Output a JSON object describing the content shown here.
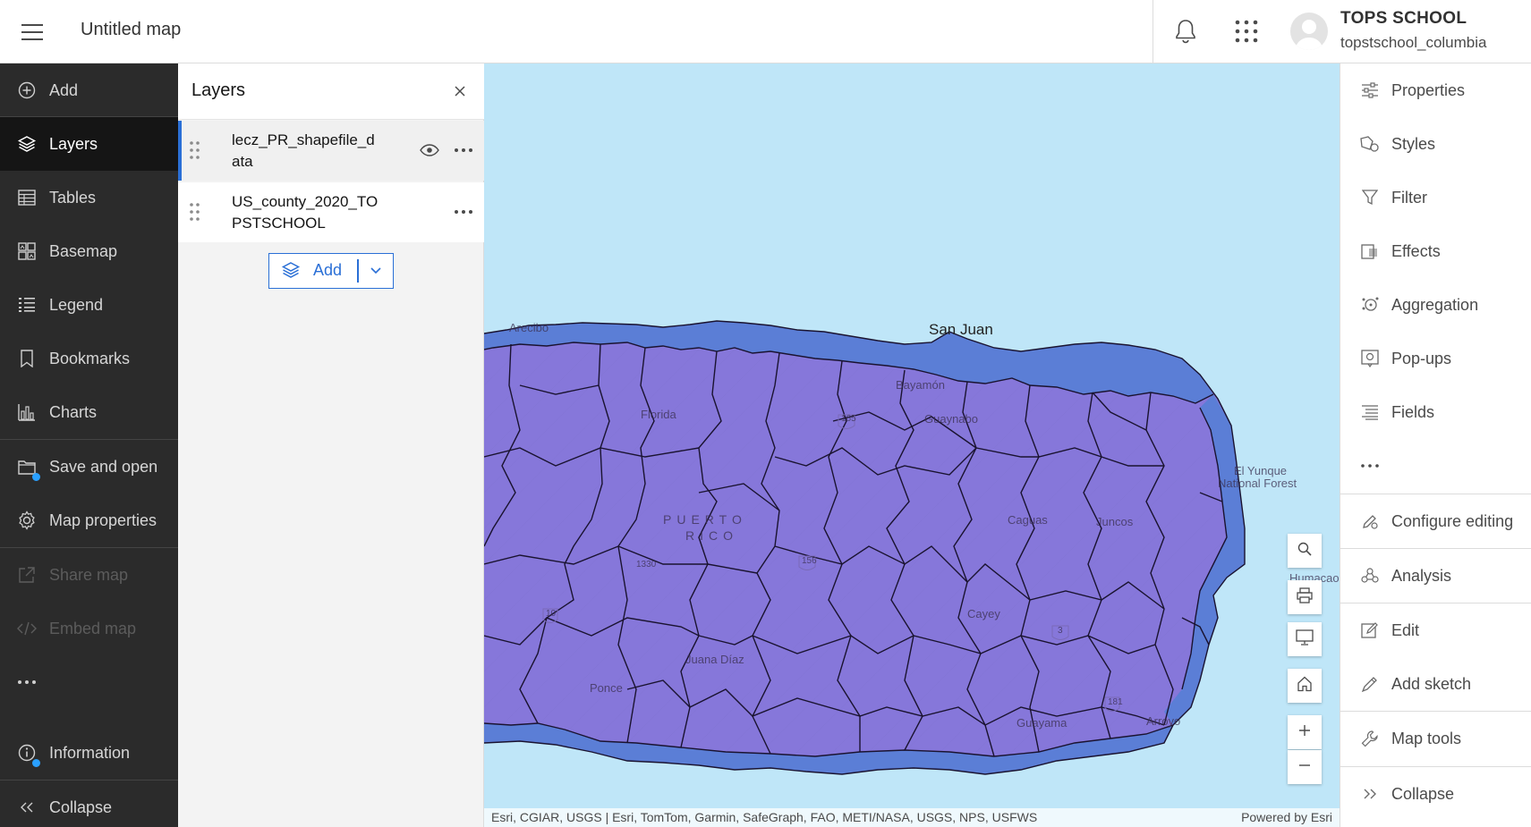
{
  "header": {
    "map_title": "Untitled map",
    "user_name": "TOPS SCHOOL",
    "user_id": "topstschool_columbia"
  },
  "left_nav": {
    "items": [
      {
        "label": "Add",
        "icon": "plus-circle-icon"
      },
      {
        "label": "Layers",
        "icon": "layers-icon",
        "active": true
      },
      {
        "label": "Tables",
        "icon": "table-icon"
      },
      {
        "label": "Basemap",
        "icon": "basemap-icon"
      },
      {
        "label": "Legend",
        "icon": "legend-icon"
      },
      {
        "label": "Bookmarks",
        "icon": "bookmark-icon"
      },
      {
        "label": "Charts",
        "icon": "chart-icon"
      },
      {
        "label": "Save and open",
        "icon": "folder-icon"
      },
      {
        "label": "Map properties",
        "icon": "gear-icon"
      },
      {
        "label": "Share map",
        "icon": "share-icon",
        "disabled": true
      },
      {
        "label": "Embed map",
        "icon": "code-icon",
        "disabled": true
      },
      {
        "label": "Information",
        "icon": "info-icon"
      },
      {
        "label": "Collapse",
        "icon": "chevrons-left-icon"
      }
    ]
  },
  "layers_panel": {
    "title": "Layers",
    "layers": [
      {
        "name": "lecz_PR_shapefile_data",
        "selected": true
      },
      {
        "name": "US_county_2020_TOPSTSCHOOL",
        "selected": false
      }
    ],
    "add_button_label": "Add"
  },
  "map": {
    "labels": {
      "san_juan": "San Juan",
      "arecibo": "Arecibo",
      "florida": "Florida",
      "guaynabo": "Guaynabo",
      "bayamon": "Bayamón",
      "puerto": "PUERTO",
      "rico": "RICO",
      "caguas": "Caguas",
      "juncos": "Juncos",
      "el_yunque": "El Yunque",
      "national_forest": "National Forest",
      "cayey": "Cayey",
      "juana_diaz": "Juana Díaz",
      "ponce": "Ponce",
      "guayama": "Guayama",
      "arroyo": "Arroyo",
      "humacao": "Humacao",
      "road_165": "165",
      "road_156": "156",
      "road_10": "10",
      "road_181": "181",
      "road_3": "3",
      "road_1330": "1330"
    },
    "attribution_left": "Esri, CGIAR, USGS | Esri, TomTom, Garmin, SafeGraph, FAO, METI/NASA, USGS, NPS, USFWS",
    "attribution_right": "Powered by Esri",
    "water_color": "#bfe6f8",
    "land_color": "#8677da",
    "lecz_color": "#5b7ed6"
  },
  "right_nav": {
    "items": [
      {
        "label": "Properties",
        "icon": "sliders-icon"
      },
      {
        "label": "Styles",
        "icon": "styles-icon"
      },
      {
        "label": "Filter",
        "icon": "filter-icon"
      },
      {
        "label": "Effects",
        "icon": "effects-icon"
      },
      {
        "label": "Aggregation",
        "icon": "aggregation-icon"
      },
      {
        "label": "Pop-ups",
        "icon": "popup-icon"
      },
      {
        "label": "Fields",
        "icon": "fields-icon"
      },
      {
        "label": "Configure editing",
        "icon": "configure-editing-icon"
      },
      {
        "label": "Analysis",
        "icon": "analysis-icon"
      },
      {
        "label": "Edit",
        "icon": "edit-icon"
      },
      {
        "label": "Add sketch",
        "icon": "sketch-icon"
      },
      {
        "label": "Map tools",
        "icon": "wrench-icon"
      },
      {
        "label": "Collapse",
        "icon": "chevrons-right-icon"
      }
    ]
  }
}
